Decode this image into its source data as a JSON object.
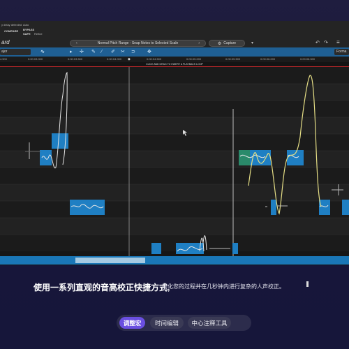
{
  "app": {
    "toolbar_left_lines": [
      "y delay detected",
      "COMPARE",
      "BYPASS",
      "SAFE",
      "Refine",
      "Auto"
    ],
    "title_fragment": "ard",
    "pitch_range_label": "Normal Pitch Range - Snap Notes to Selected Scale",
    "capture_label": "Capture",
    "scale_field": "ajor",
    "format_tab": "Forma",
    "loop_hint": "CLICK AND DRAG TO INSERT A PLAYBACK LOOP"
  },
  "timeline": {
    "ticks": [
      "4.500",
      "0:00:03.000",
      "0:00:03.500",
      "0:00:04.000",
      "0:00:04.500",
      "0:00:05.000",
      "0:00:05.500",
      "0:00:06.000",
      "0:00:06.500"
    ]
  },
  "caption": {
    "main": "使用一系列直观的音高校正快捷方式,",
    "sub": "简化您的过程并在几秒钟内进行复杂的人声校正。"
  },
  "tabs": [
    {
      "label": "调整宏",
      "active": true
    },
    {
      "label": "时间编辑",
      "active": false
    },
    {
      "label": "中心注释工具",
      "active": false
    }
  ],
  "colors": {
    "background": "#1d1b3e",
    "toolstrip": "#1f5f93",
    "note_block": "#1f7fc3",
    "pitch_curve_white": "#e6e6e6",
    "pitch_curve_yellow": "#e6df86",
    "active_tab": "#6a4fe0",
    "loop_line": "#c0282a"
  }
}
